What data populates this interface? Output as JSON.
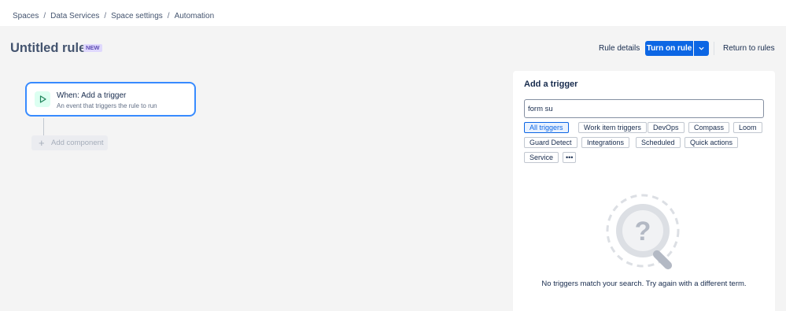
{
  "breadcrumb": {
    "items": [
      "Spaces",
      "Data Services",
      "Space settings",
      "Automation"
    ],
    "separator": "/"
  },
  "header": {
    "title": "Untitled rule",
    "badge": "NEW",
    "rule_details_label": "Rule details",
    "turn_on_label": "Turn on rule",
    "return_label": "Return to rules"
  },
  "canvas": {
    "trigger_title": "When: Add a trigger",
    "trigger_subtitle": "An event that triggers the rule to run",
    "add_component_label": "Add component"
  },
  "panel": {
    "title": "Add a trigger",
    "search_value": "form su",
    "chips": [
      {
        "label": "All triggers",
        "selected": true
      },
      {
        "label": "Work item triggers",
        "selected": false
      },
      {
        "label": "DevOps",
        "selected": false
      },
      {
        "label": "Compass",
        "selected": false
      },
      {
        "label": "Loom",
        "selected": false
      },
      {
        "label": "Guard Detect",
        "selected": false
      },
      {
        "label": "Integrations",
        "selected": false
      },
      {
        "label": "Scheduled",
        "selected": false
      },
      {
        "label": "Quick actions",
        "selected": false
      },
      {
        "label": "Service",
        "selected": false
      }
    ],
    "more_label": "•••",
    "empty_message": "No triggers match your search. Try again with a different term."
  },
  "colors": {
    "primary": "#0c66e4",
    "badge_bg": "#dfd8fd",
    "trigger_border": "#388bff"
  }
}
